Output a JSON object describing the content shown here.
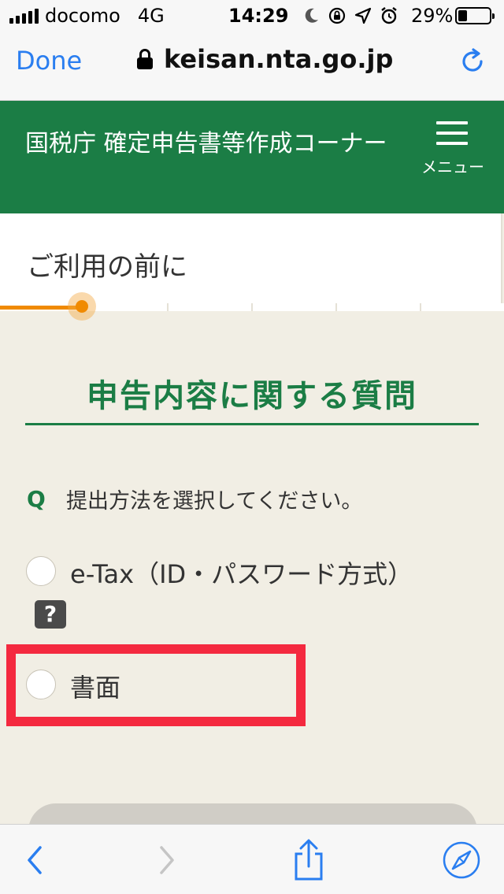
{
  "status_bar": {
    "carrier": "docomo",
    "network": "4G",
    "time": "14:29",
    "battery": "29%",
    "battery_level": 0.29
  },
  "browser": {
    "done_label": "Done",
    "url": "keisan.nta.go.jp",
    "accent_color": "#2a7ef0"
  },
  "header": {
    "title": "国税庁 確定申告書等作成コーナー",
    "menu_label": "メニュー",
    "color": "#1b7d45"
  },
  "step": {
    "title": "ご利用の前に",
    "progress_color": "#f08a00"
  },
  "main": {
    "section_title": "申告内容に関する質問",
    "question_mark": "Q",
    "question_text": "提出方法を選択してください。",
    "options": [
      {
        "label": "e-Tax（ID・パスワード方式）",
        "selected": false
      },
      {
        "label": "書面",
        "selected": false
      }
    ],
    "help_icon_text": "?",
    "highlight_color": "#f4293f"
  },
  "toolbar": {
    "icons": [
      "back-icon",
      "forward-icon",
      "share-icon",
      "compass-icon"
    ]
  }
}
